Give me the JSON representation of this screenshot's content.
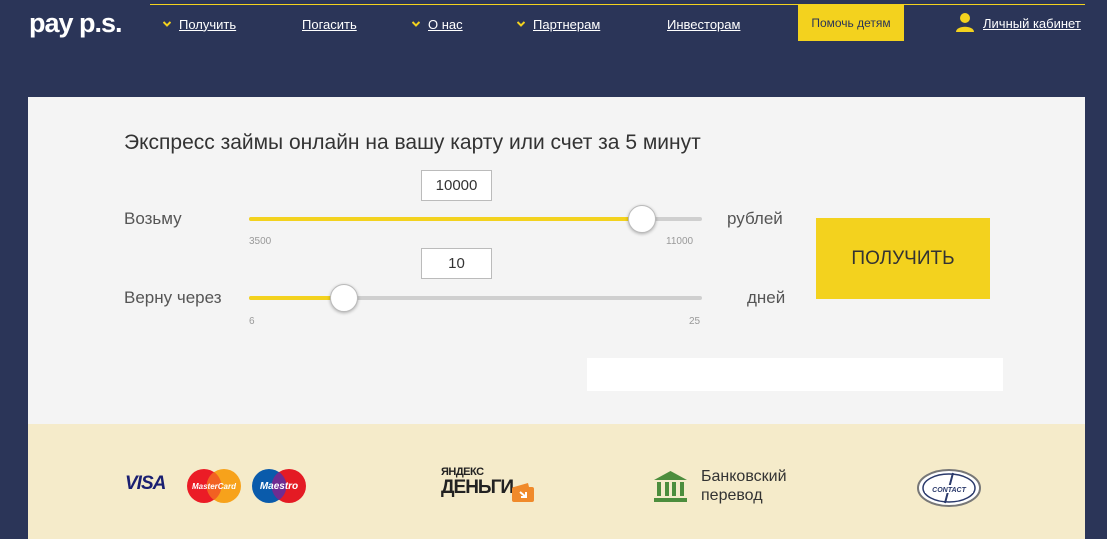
{
  "brand": {
    "logo_text": "pay",
    "logo_ps": "p.s."
  },
  "nav": {
    "items": [
      {
        "label": "Получить"
      },
      {
        "label": "Погасить"
      },
      {
        "label": "О нас"
      },
      {
        "label": "Партнерам"
      },
      {
        "label": "Инвесторам"
      }
    ],
    "help_label": "Помочь детям",
    "cabinet_label": "Личный кабинет"
  },
  "calculator": {
    "title": "Экспресс займы онлайн на вашу карту или счет за 5 минут",
    "amount": {
      "label": "Возьму",
      "value": "10000",
      "unit": "рублей",
      "min": "3500",
      "max": "11000",
      "fraction": 0.8667
    },
    "term": {
      "label": "Верну через",
      "value": "10",
      "unit": "дней",
      "min": "6",
      "max": "25",
      "fraction": 0.2105
    },
    "submit_label": "ПОЛУЧИТЬ"
  },
  "payments": {
    "visa": "VISA",
    "mastercard": "MasterCard",
    "maestro": "Maestro",
    "yandex_top": "ЯНДЕКС",
    "yandex_bottom": "ДЕНЬГИ",
    "bank_line1": "Банковский",
    "bank_line2": "перевод",
    "contact": "CONTACT"
  },
  "colors": {
    "accent": "#f3d21e",
    "header_bg": "#2b3558",
    "panel_bg": "#f4f4f4",
    "strip_bg": "#f5ebca"
  }
}
